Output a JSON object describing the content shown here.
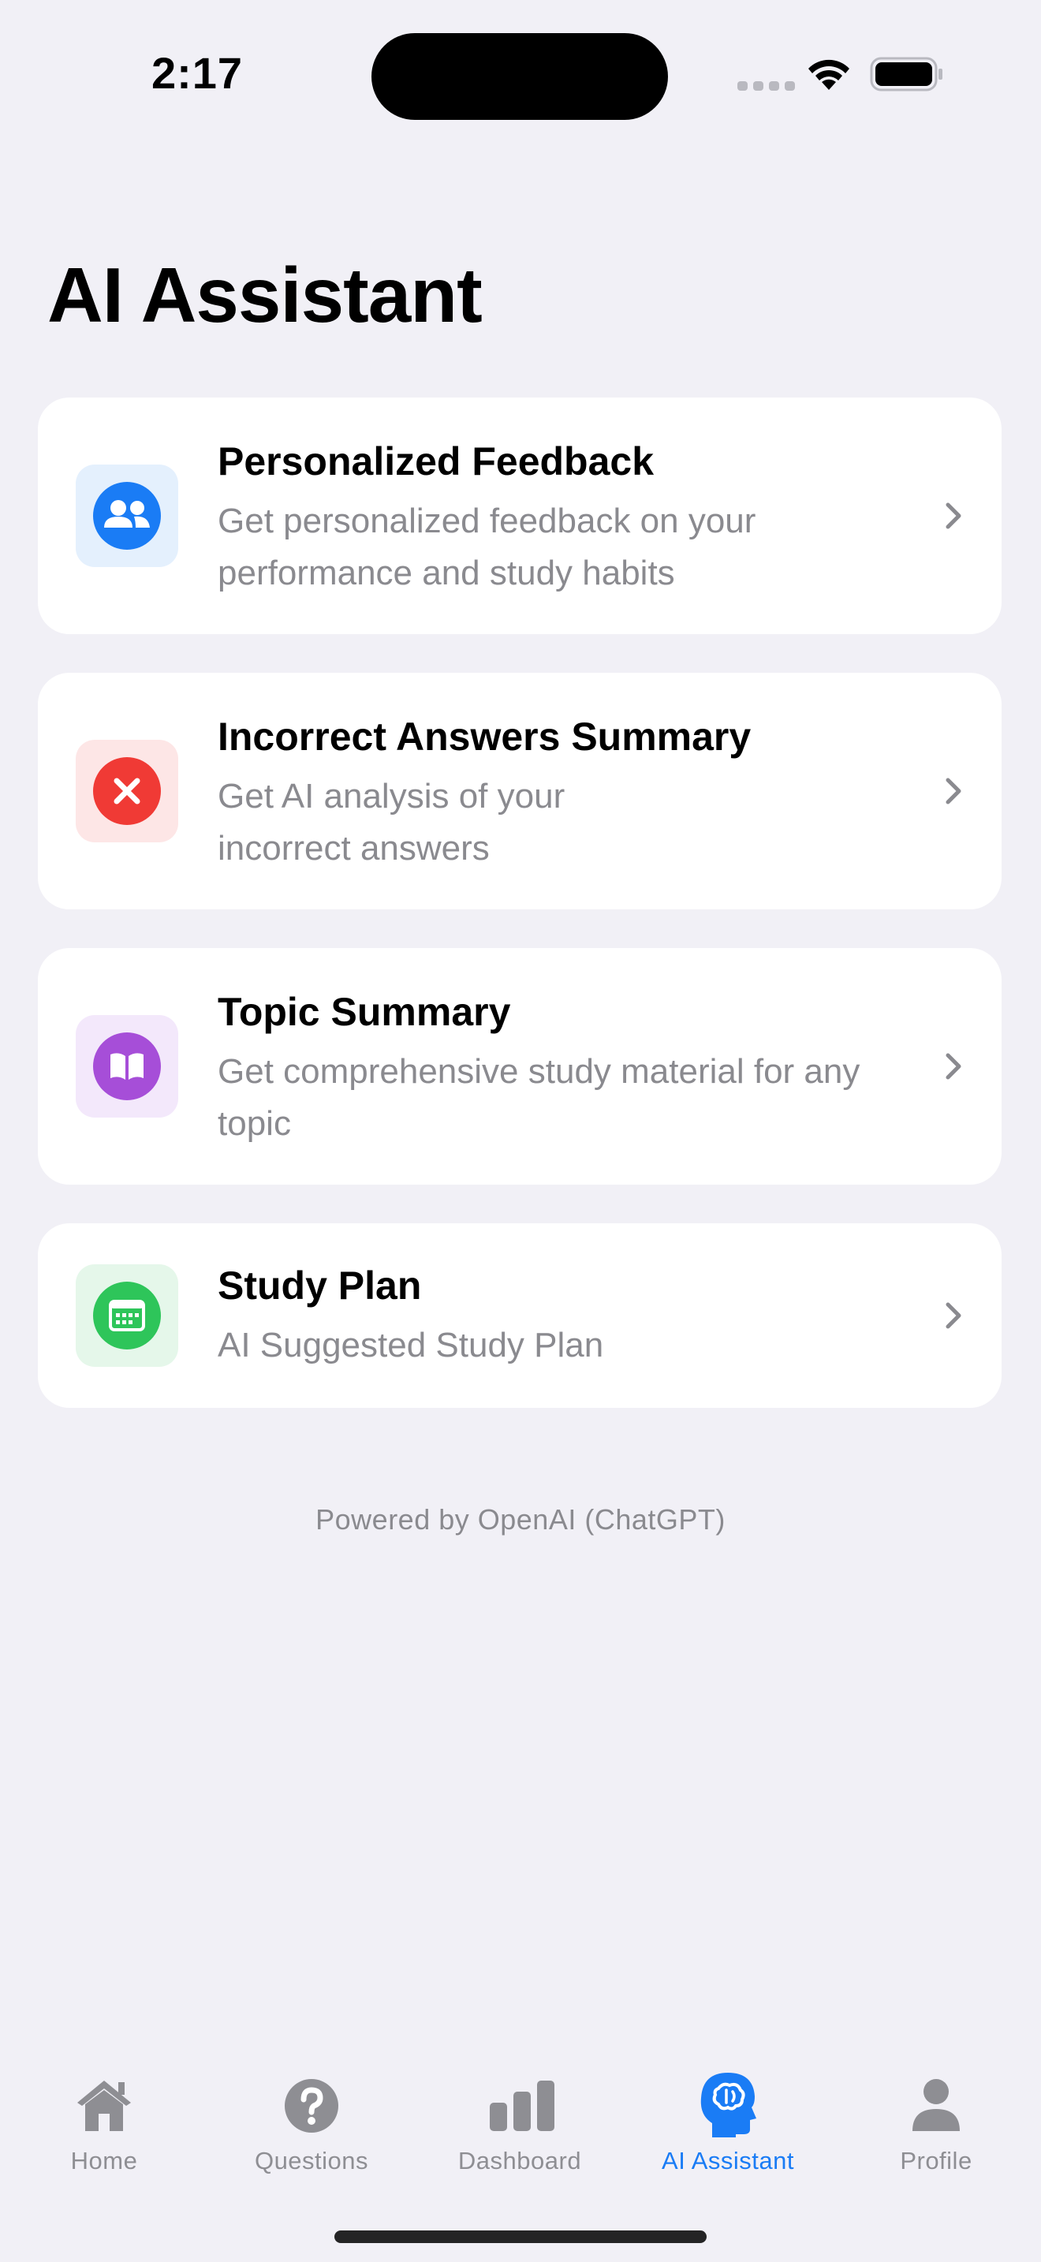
{
  "status_bar": {
    "time": "2:17"
  },
  "page": {
    "title": "AI Assistant"
  },
  "cards": [
    {
      "title": "Personalized Feedback",
      "subtitle": "Get personalized feedback on your performance and study habits",
      "icon": "people-icon",
      "color": "#1a7cf5"
    },
    {
      "title": "Incorrect Answers Summary",
      "subtitle": "Get AI analysis of your incorrect answers",
      "icon": "xmark-icon",
      "color": "#f03a35"
    },
    {
      "title": "Topic Summary",
      "subtitle": "Get comprehensive study material for any topic",
      "icon": "book-icon",
      "color": "#a64ed8"
    },
    {
      "title": "Study Plan",
      "subtitle": "AI Suggested Study Plan",
      "icon": "calendar-icon",
      "color": "#2ec55a"
    }
  ],
  "footer": {
    "powered_by": "Powered by OpenAI (ChatGPT)"
  },
  "tab_bar": {
    "tabs": [
      {
        "label": "Home",
        "icon": "house-icon",
        "active": false
      },
      {
        "label": "Questions",
        "icon": "question-icon",
        "active": false
      },
      {
        "label": "Dashboard",
        "icon": "chart-bar-icon",
        "active": false
      },
      {
        "label": "AI Assistant",
        "icon": "brain-head-icon",
        "active": true
      },
      {
        "label": "Profile",
        "icon": "person-icon",
        "active": false
      }
    ],
    "active_color": "#1a7cf5",
    "inactive_color": "#8e8e93"
  }
}
